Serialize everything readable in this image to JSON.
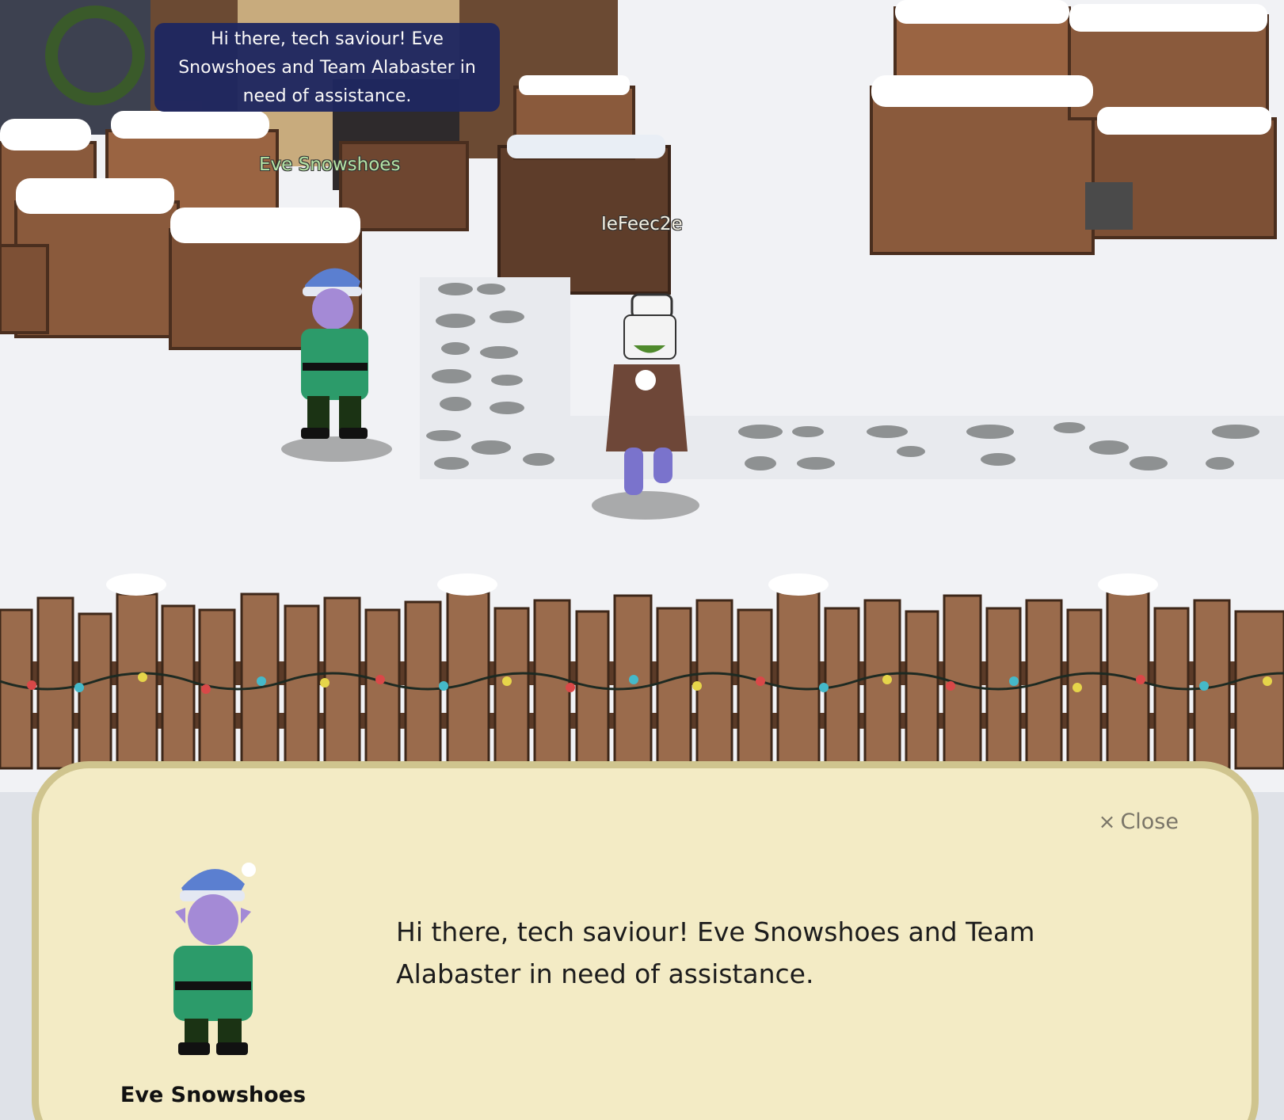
{
  "speech_bubble": {
    "text": "Hi there, tech saviour! Eve Snowshoes and Team Alabaster in need of assistance."
  },
  "npc": {
    "name": "Eve Snowshoes"
  },
  "player": {
    "name": "IeFeec2e"
  },
  "dialog": {
    "close_label": "Close",
    "close_icon": "×",
    "text": "Hi there, tech saviour! Eve Snowshoes and Team Alabaster in need of assistance.",
    "speaker_name": "Eve Snowshoes"
  },
  "colors": {
    "snow": "#f1f2f5",
    "wood": "#8a5a3c",
    "speech_bubble": "#1f2760",
    "npc_label": "#b5e3a5",
    "dialog_background": "#f3ebc5",
    "dialog_border": "#cfc48e"
  }
}
